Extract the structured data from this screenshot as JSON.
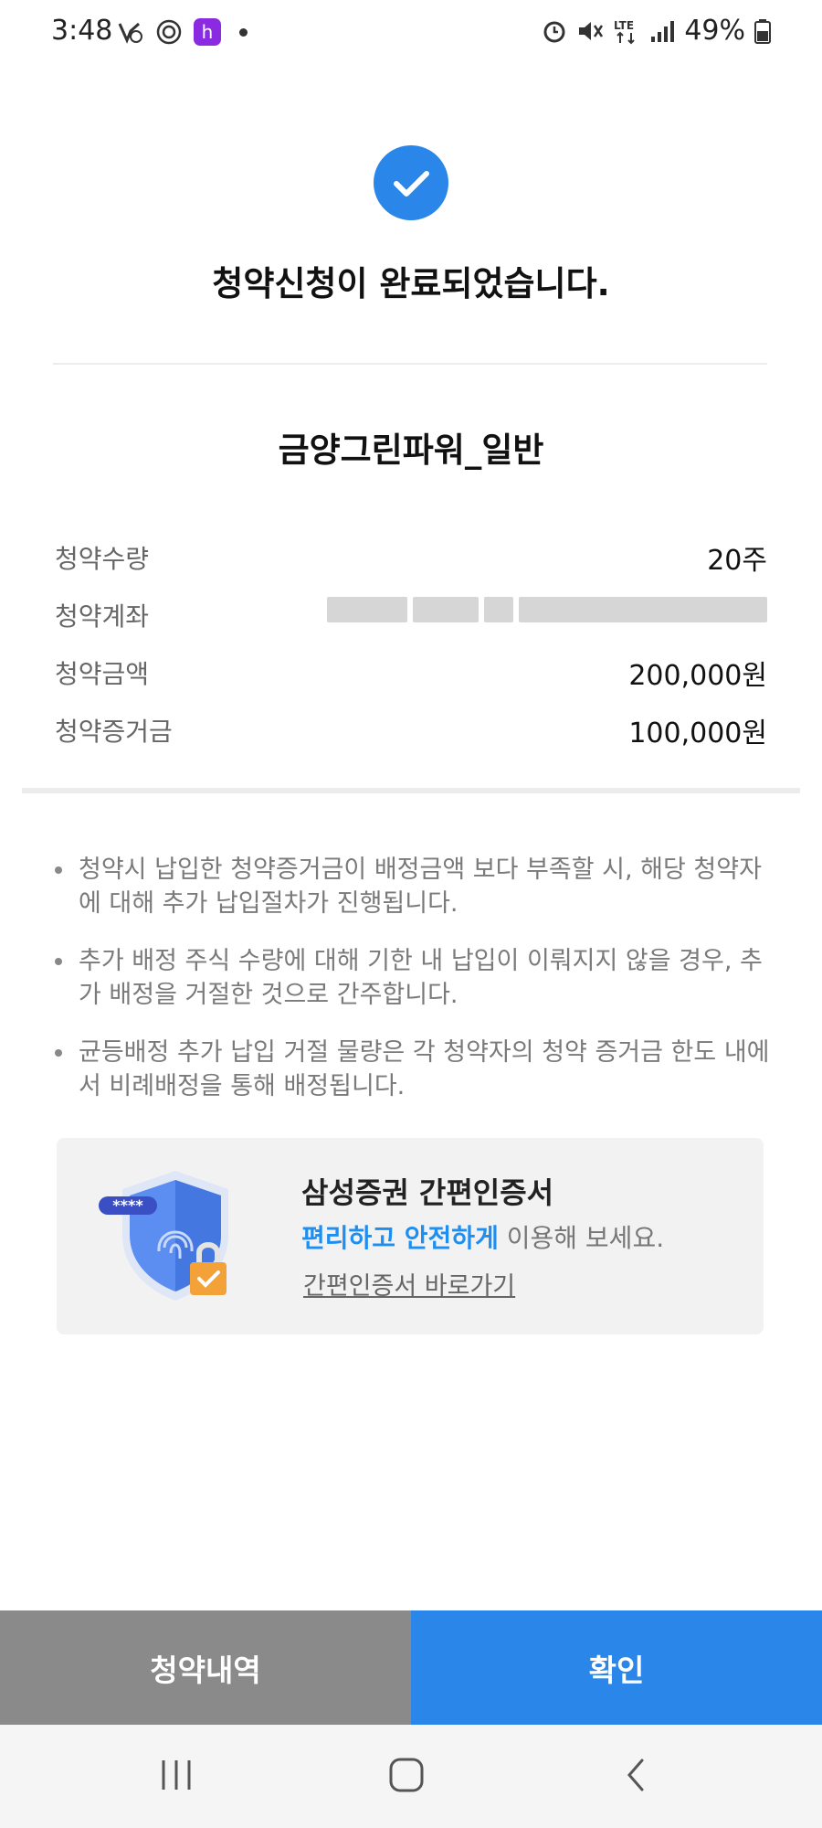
{
  "status_bar": {
    "time": "3:48",
    "battery_percent": "49%",
    "icons": [
      "vpn-icon",
      "sync-icon",
      "h-app-icon",
      "alarm-icon",
      "mute-icon",
      "lte-icon",
      "signal-icon",
      "battery-icon"
    ]
  },
  "success": {
    "title": "청약신청이 완료되었습니다.",
    "product_name": "금양그린파워_일반"
  },
  "info": [
    {
      "label": "청약수량",
      "value": "20주"
    },
    {
      "label": "청약계좌",
      "value": ""
    },
    {
      "label": "청약금액",
      "value": "200,000원"
    },
    {
      "label": "청약증거금",
      "value": "100,000원"
    }
  ],
  "notes": [
    "청약시 납입한 청약증거금이 배정금액 보다 부족할 시, 해당 청약자에 대해 추가 납입절차가 진행됩니다.",
    "추가 배정 주식 수량에 대해 기한 내 납입이 이뤄지지 않을 경우, 추가 배정을 거절한 것으로 간주합니다.",
    "균등배정 추가 납입 거절 물량은 각 청약자의 청약 증거금 한도 내에서 비례배정을 통해 배정됩니다."
  ],
  "cert": {
    "title": "삼성증권 간편인증서",
    "highlight": "편리하고 안전하게",
    "desc_rest": " 이용해 보세요.",
    "link": "간편인증서 바로가기",
    "password_mask": "****"
  },
  "buttons": {
    "history": "청약내역",
    "confirm": "확인"
  },
  "colors": {
    "accent": "#2a86e8",
    "gray_button": "#8a8a8a",
    "highlight_text": "#1f8ef1",
    "lock": "#f3a23a"
  }
}
